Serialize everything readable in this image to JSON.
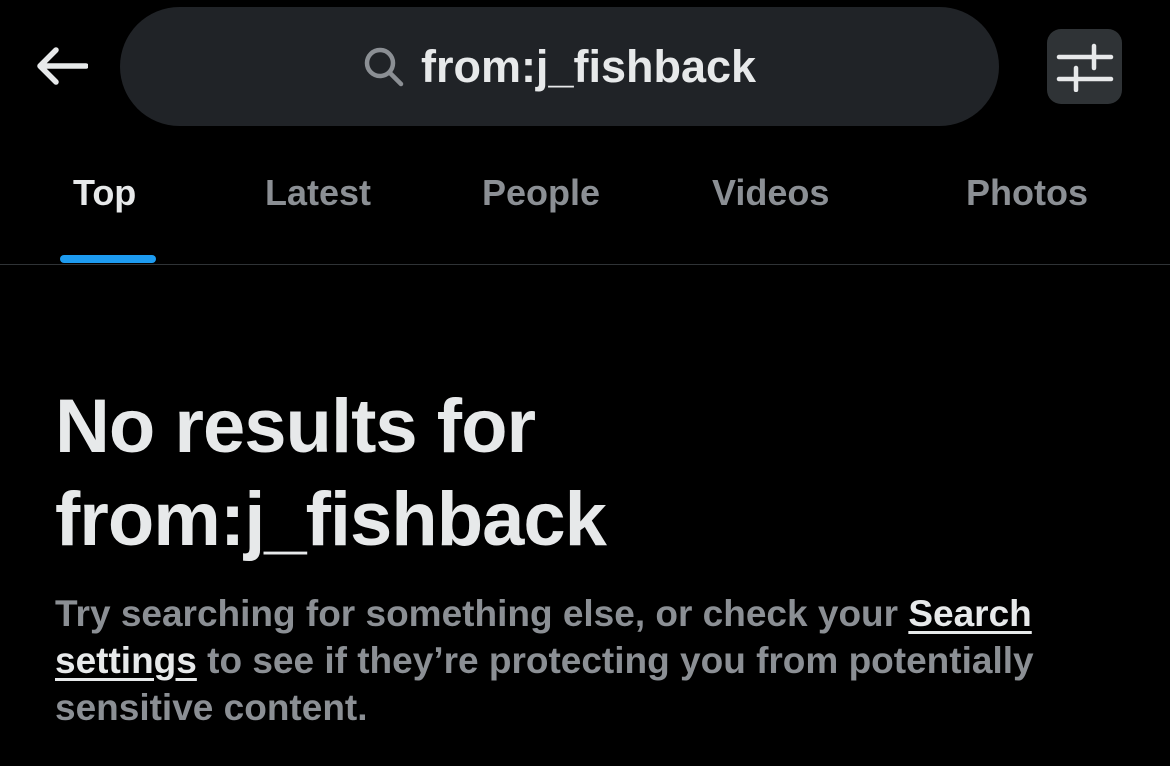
{
  "header": {
    "back_icon": "arrow-left-icon",
    "search": {
      "icon": "search-icon",
      "query": "from:j_fishback"
    },
    "filter_icon": "sliders-icon"
  },
  "tabs": [
    {
      "label": "Top",
      "active": true
    },
    {
      "label": "Latest",
      "active": false
    },
    {
      "label": "People",
      "active": false
    },
    {
      "label": "Videos",
      "active": false
    },
    {
      "label": "Photos",
      "active": false
    }
  ],
  "empty_state": {
    "title_line1": "No results for",
    "title_line2": "from:j_fishback",
    "desc_before": "Try searching for something else, or check your ",
    "desc_link": "Search settings",
    "desc_after": " to see if they’re protecting you from potentially sensitive content."
  },
  "colors": {
    "background": "#000000",
    "accent": "#1d9bf0",
    "primary_text": "#e7e9ea",
    "secondary_text": "#8b8f94",
    "search_bg": "#202327"
  }
}
